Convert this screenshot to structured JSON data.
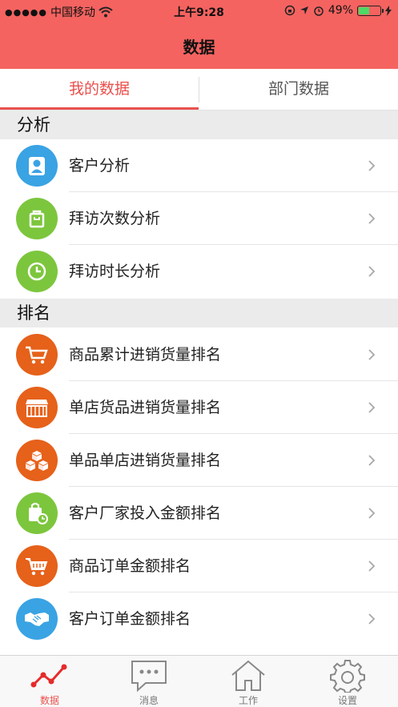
{
  "status_bar": {
    "carrier": "中国移动",
    "time": "上午9:28",
    "battery_percent": "49%",
    "battery_level": 0.49
  },
  "header": {
    "title": "数据"
  },
  "tabs": [
    {
      "label": "我的数据",
      "active": true
    },
    {
      "label": "部门数据",
      "active": false
    }
  ],
  "sections": [
    {
      "title": "分析",
      "items": [
        {
          "label": "客户分析",
          "icon": "person-icon",
          "color": "#3aa3e3"
        },
        {
          "label": "拜访次数分析",
          "icon": "bag-icon",
          "color": "#7cc63d"
        },
        {
          "label": "拜访时长分析",
          "icon": "clock-icon",
          "color": "#7cc63d"
        }
      ]
    },
    {
      "title": "排名",
      "items": [
        {
          "label": "商品累计进销货量排名",
          "icon": "cart-icon",
          "color": "#e6611a"
        },
        {
          "label": "单店货品进销货量排名",
          "icon": "store-icon",
          "color": "#e6611a"
        },
        {
          "label": "单品单店进销货量排名",
          "icon": "boxes-icon",
          "color": "#e6611a"
        },
        {
          "label": "客户厂家投入金额排名",
          "icon": "shopping-bag-clock-icon",
          "color": "#7cc63d"
        },
        {
          "label": "商品订单金额排名",
          "icon": "cart-icon",
          "color": "#e6611a"
        },
        {
          "label": "客户订单金额排名",
          "icon": "handshake-icon",
          "color": "#3aa3e3"
        }
      ]
    }
  ],
  "bottom_nav": [
    {
      "label": "数据",
      "icon": "chart-line-icon",
      "active": true
    },
    {
      "label": "消息",
      "icon": "message-icon",
      "active": false
    },
    {
      "label": "工作",
      "icon": "home-icon",
      "active": false
    },
    {
      "label": "设置",
      "icon": "gear-icon",
      "active": false
    }
  ],
  "colors": {
    "accent": "#f46360",
    "active_text": "#e9514d"
  }
}
